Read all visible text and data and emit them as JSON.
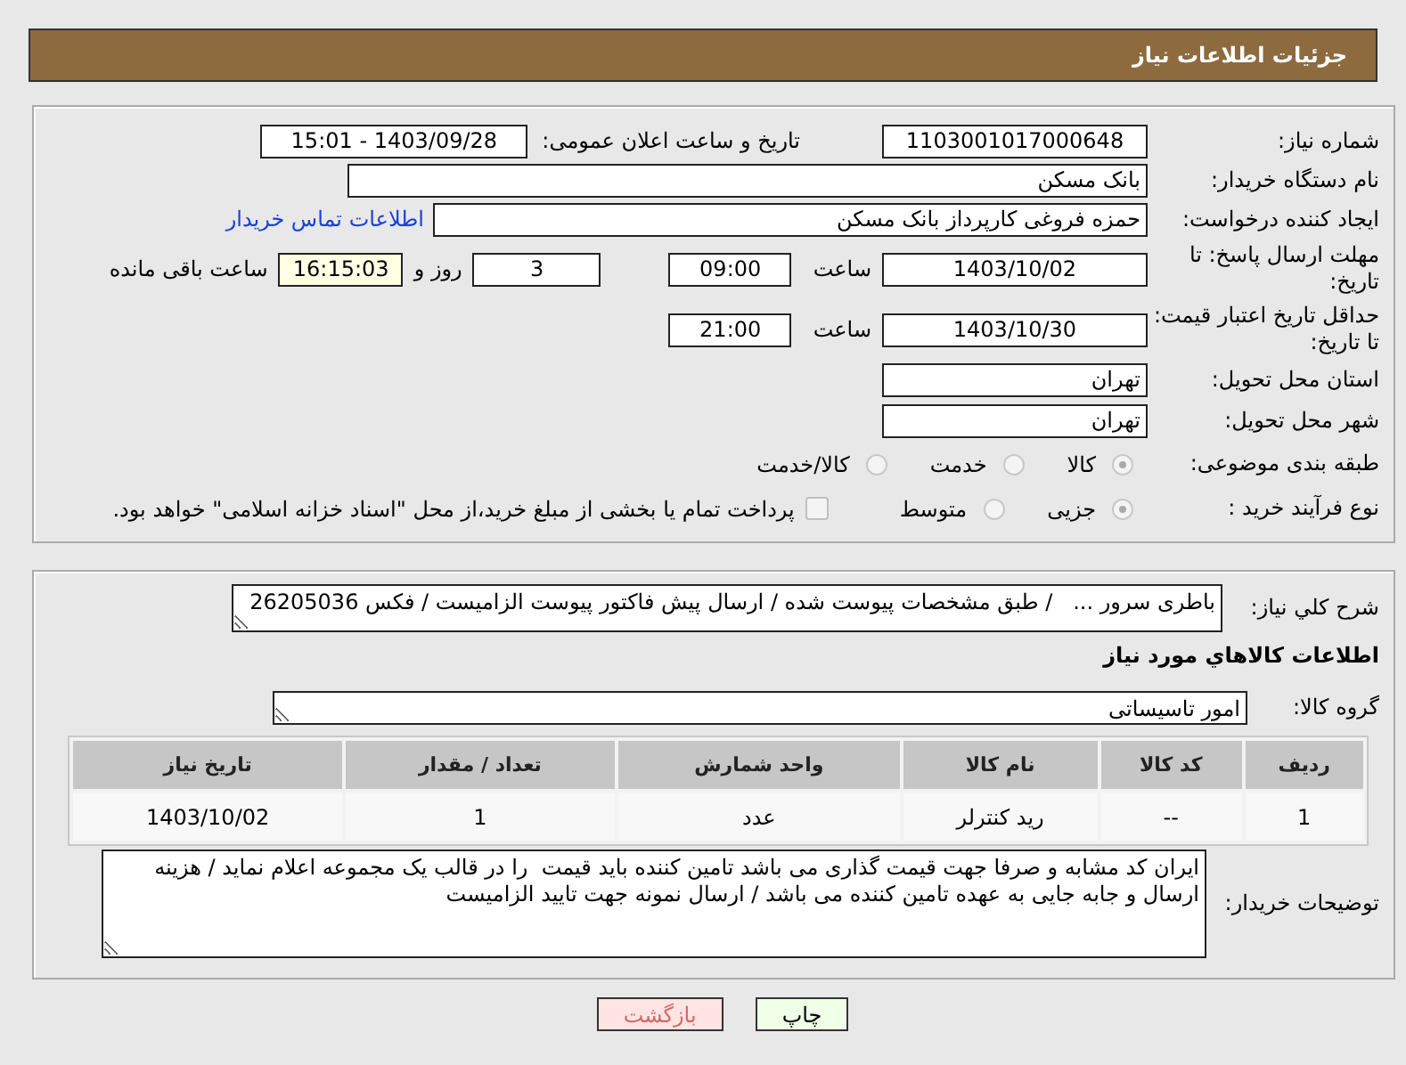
{
  "header": {
    "title": "جزئیات اطلاعات نیاز"
  },
  "need_number": {
    "label": "شماره نیاز:",
    "value": "1103001017000648"
  },
  "announce": {
    "label": "تاریخ و ساعت اعلان عمومی:",
    "value": "1403/09/28 - 15:01"
  },
  "buyer_org": {
    "label": "نام دستگاه خریدار:",
    "value": "بانک مسکن"
  },
  "requester": {
    "label": "ایجاد کننده درخواست:",
    "value": "حمزه فروغی کارپرداز بانک مسکن",
    "link": "اطلاعات تماس خریدار"
  },
  "reply_deadline": {
    "label": "مهلت ارسال پاسخ: تا تاریخ:",
    "date": "1403/10/02",
    "time_label": "ساعت",
    "time": "09:00",
    "days": "3",
    "days_label": "روز و",
    "remaining": "16:15:03",
    "remaining_label": "ساعت باقی مانده"
  },
  "price_validity": {
    "label": "حداقل تاریخ اعتبار قیمت: تا تاریخ:",
    "date": "1403/10/30",
    "time_label": "ساعت",
    "time": "21:00"
  },
  "province": {
    "label": "استان محل تحویل:",
    "value": "تهران"
  },
  "city": {
    "label": "شهر محل تحویل:",
    "value": "تهران"
  },
  "category": {
    "label": "طبقه بندی موضوعی:",
    "options": [
      {
        "label": "کالا",
        "selected": true
      },
      {
        "label": "خدمت",
        "selected": false
      },
      {
        "label": "کالا/خدمت",
        "selected": false
      }
    ]
  },
  "process": {
    "label": "نوع فرآیند خرید :",
    "options": [
      {
        "label": "جزیی",
        "selected": true
      },
      {
        "label": "متوسط",
        "selected": false
      }
    ],
    "payment": {
      "checked": false,
      "text": "پرداخت تمام یا بخشی از مبلغ خرید،از محل \"اسناد خزانه اسلامی\" خواهد بود."
    }
  },
  "description": {
    "label": "شرح كلي نياز:",
    "value": "باطری سرور ...   / طبق مشخصات پیوست شده / ارسال پیش فاکتور پیوست الزامیست / فکس 26205036"
  },
  "goods_heading": "اطلاعات كالاهاي مورد نياز",
  "goods_group": {
    "label": "گروه کالا:",
    "value": "امور تاسیساتی"
  },
  "table": {
    "columns": [
      "ردیف",
      "کد کالا",
      "نام کالا",
      "واحد شمارش",
      "تعداد / مقدار",
      "تاریخ نیاز"
    ],
    "rows": [
      [
        "1",
        "--",
        "رید کنترلر",
        "عدد",
        "1",
        "1403/10/02"
      ]
    ]
  },
  "buyer_notes": {
    "label": "توضیحات خریدار:",
    "value": "ایران کد مشابه و صرفا جهت قیمت گذاری می باشد تامین کننده باید قیمت  را در قالب یک مجموعه اعلام نماید / هزینه ارسال و جابه جایی به عهده تامین کننده می باشد / ارسال نمونه جهت تایید الزامیست"
  },
  "buttons": [
    {
      "label": "چاپ",
      "kind": "print"
    },
    {
      "label": "بازگشت",
      "kind": "back"
    }
  ]
}
